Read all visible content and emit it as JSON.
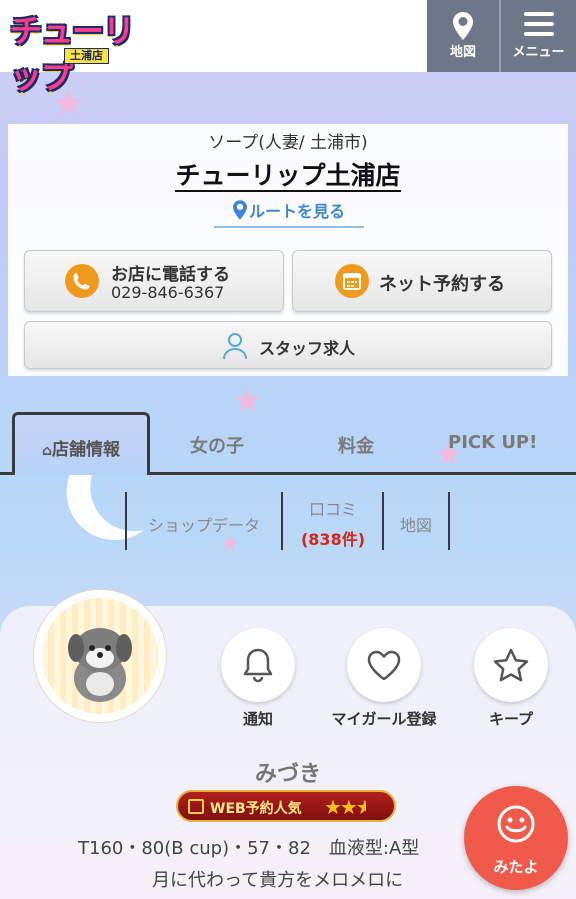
{
  "header": {
    "logo_main": "チューリップ",
    "logo_sub": "土浦店",
    "map_label": "地図",
    "menu_label": "メニュー"
  },
  "shop": {
    "category": "ソープ(人妻/ 土浦市)",
    "name": "チューリップ土浦店",
    "route_label": "ルートを見る",
    "call_label": "お店に電話する",
    "phone": "029-846-6367",
    "reserve_label": "ネット予約する",
    "staff_label": "スタッフ求人"
  },
  "tabs": [
    {
      "label": "店舗情報",
      "active": true
    },
    {
      "label": "女の子",
      "active": false
    },
    {
      "label": "料金",
      "active": false
    },
    {
      "label": "PICK UP!",
      "active": false
    }
  ],
  "subnav": {
    "shop_data": "ショップデータ",
    "reviews": "口コミ",
    "reviews_count": "(838件)",
    "map": "地図"
  },
  "girl": {
    "actions": {
      "notify": "通知",
      "my_girl": "マイガール登録",
      "keep": "キープ"
    },
    "name": "みづき",
    "badge_text": "WEB予約人気",
    "badge_stars": 2.5,
    "specs": "T160・80(B cup)・57・82　血液型:A型",
    "catchphrase": "月に代わって貴方をメロメロに"
  },
  "float_button": {
    "label": "みたよ"
  },
  "colors": {
    "accent_orange": "#f09a1d",
    "link_blue": "#3d86d6",
    "count_red": "#d0281b",
    "float_red": "#ef5a4a"
  }
}
